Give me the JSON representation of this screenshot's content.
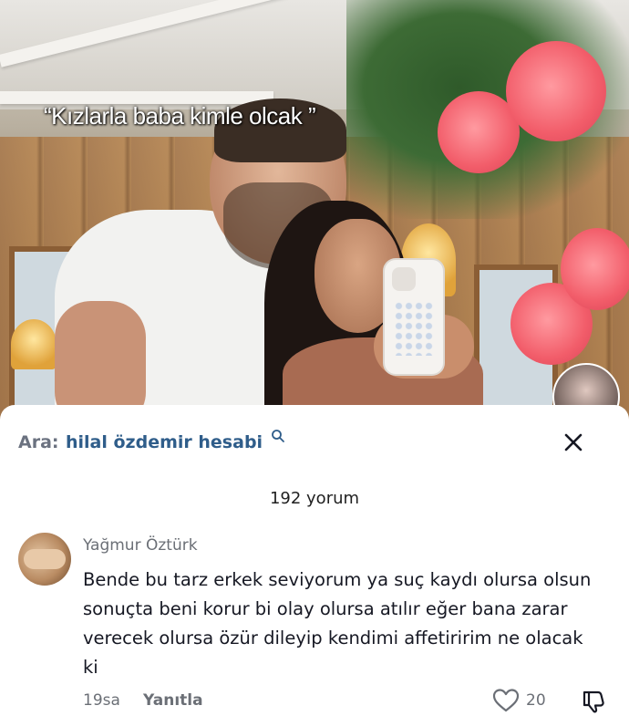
{
  "video": {
    "caption": "“Kızlarla baba kimle olcak ”",
    "creator_avatar": "creator-avatar"
  },
  "comments_sheet": {
    "search": {
      "prefix": "Ara:",
      "term": "hilal özdemir hesabi",
      "icon": "search-icon"
    },
    "close_icon": "close-icon",
    "count_label": "192 yorum",
    "comments": [
      {
        "username": "Yağmur Öztürk",
        "text": "Bende bu tarz erkek seviyorum ya suç kaydı olursa olsun sonuçta beni korur bi olay olursa atılır eğer bana zarar verecek olursa özür dileyip kendimi affetiririm ne olacak ki",
        "time": "19sa",
        "reply_label": "Yanıtla",
        "like_count": "20",
        "like_icon": "heart-outline-icon",
        "dislike_icon": "dislike-icon"
      }
    ]
  },
  "colors": {
    "link_blue": "#2f5d8a",
    "muted_gray": "#6b6f76",
    "text_dark": "#161823"
  }
}
